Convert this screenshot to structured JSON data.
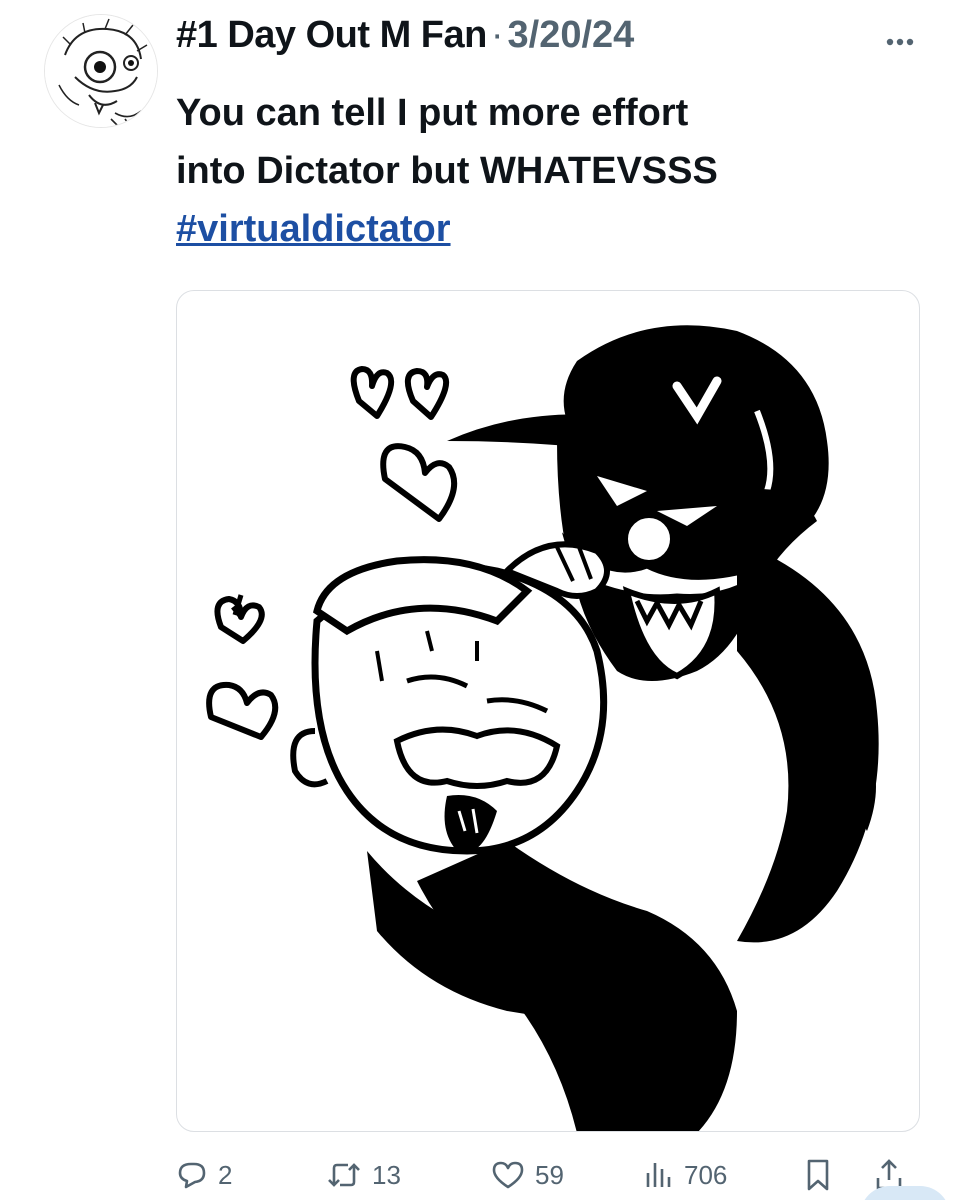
{
  "tweet": {
    "display_name": "#1 Day Out M Fan",
    "separator": "·",
    "date": "3/20/24",
    "text_line1": "You can tell I put more effort",
    "text_line2": "into Dictator but WHATEVSSS",
    "hashtag": "#virtualdictator",
    "more_icon": "more-horizontal-icon"
  },
  "actions": {
    "replies": "2",
    "retweets": "13",
    "likes": "59",
    "views": "706",
    "icons": [
      "reply-icon",
      "retweet-icon",
      "like-icon",
      "views-icon",
      "bookmark-icon",
      "share-icon"
    ]
  },
  "colors": {
    "text": "#0f1419",
    "muted": "#536471",
    "link": "#1d4fa3",
    "border": "#dcdfe3"
  }
}
